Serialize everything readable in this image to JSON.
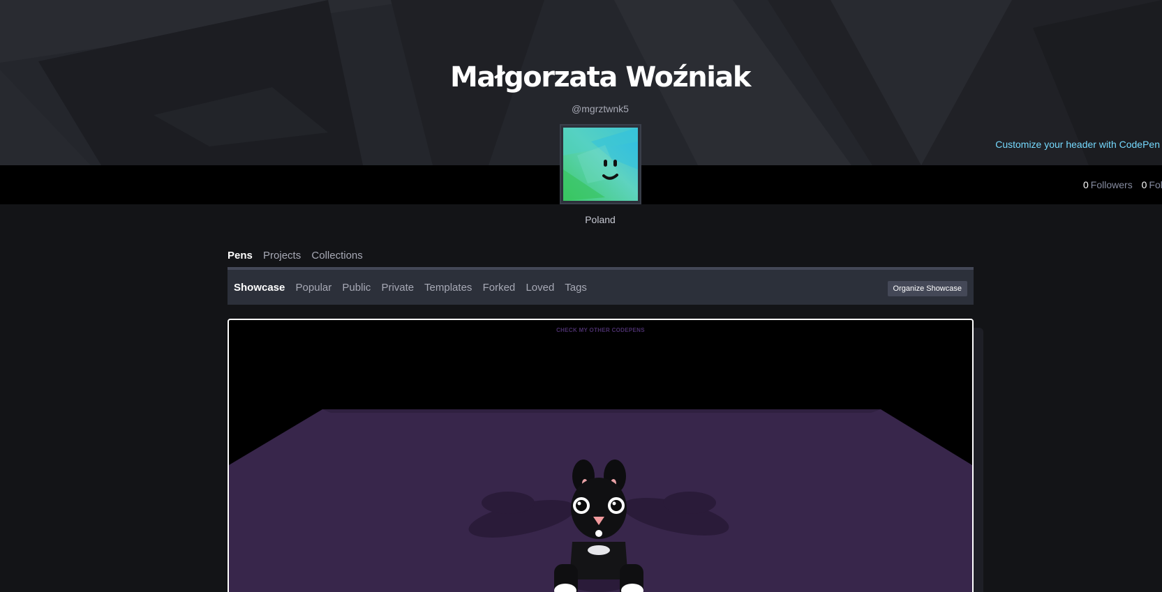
{
  "profile": {
    "name": "Małgorzata Woźniak",
    "handle": "@mgrztwnk5",
    "location": "Poland",
    "customize_link": "Customize your header with CodePen"
  },
  "stats": [
    {
      "count": "0",
      "label": "Followers"
    },
    {
      "count": "0",
      "label": "Foll"
    }
  ],
  "main_tabs": [
    {
      "label": "Pens",
      "active": true
    },
    {
      "label": "Projects",
      "active": false
    },
    {
      "label": "Collections",
      "active": false
    }
  ],
  "sub_tabs": [
    {
      "label": "Showcase",
      "active": true
    },
    {
      "label": "Popular",
      "active": false
    },
    {
      "label": "Public",
      "active": false
    },
    {
      "label": "Private",
      "active": false
    },
    {
      "label": "Templates",
      "active": false
    },
    {
      "label": "Forked",
      "active": false
    },
    {
      "label": "Loved",
      "active": false
    },
    {
      "label": "Tags",
      "active": false
    }
  ],
  "organize_button": "Organize Showcase",
  "preview": {
    "link_text": "CHECK MY OTHER CODEPENS",
    "floor_color": "#38264b"
  },
  "colors": {
    "accent_link": "#76daff",
    "background": "#131417",
    "header": "#24262c"
  },
  "icons": {
    "avatar": "smiley-face-avatar",
    "mascot": "black-kitten-3d-figure"
  }
}
